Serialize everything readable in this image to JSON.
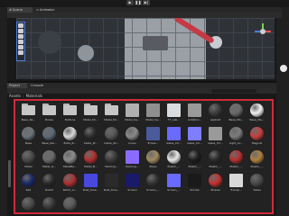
{
  "window": {
    "tabs": [
      {
        "label": "# Scene"
      },
      {
        "label": "≈ Animator"
      }
    ],
    "play_controls": [
      "▶",
      "❚❚",
      "▶|"
    ]
  },
  "project": {
    "tabs": [
      {
        "label": "Project"
      },
      {
        "label": "Console"
      }
    ],
    "search_placeholder": "",
    "breadcrumb": [
      "Assets",
      "Materials"
    ]
  },
  "colors": {
    "selection_frame": "#d12a3a",
    "accent_blue": "#4a7be0"
  },
  "assets": [
    {
      "label": "Base_Re...",
      "kind": "folder",
      "color": "#c6c6c6"
    },
    {
      "label": "Boxes",
      "kind": "folder",
      "color": "#c6c6c6"
    },
    {
      "label": "Buttons",
      "kind": "folder",
      "color": "#c6c6c6"
    },
    {
      "label": "Metal_Sh...",
      "kind": "folder",
      "color": "#c6c6c6"
    },
    {
      "label": "Metal_Sh...",
      "kind": "folder",
      "color": "#c6c6c6"
    },
    {
      "label": "Metal_Sq...",
      "kind": "square",
      "color": "#b0b0b0"
    },
    {
      "label": "Metal_Sq...",
      "kind": "square",
      "color": "#8f8f8f"
    },
    {
      "label": "TT_Lab...",
      "kind": "square",
      "color": "#d8dcdf"
    },
    {
      "label": "Antishro...",
      "kind": "square",
      "color": "#9a9a9a"
    },
    {
      "label": "Asphalt",
      "kind": "ball",
      "color": "#3d3d3d"
    },
    {
      "label": "Base_Ma...",
      "kind": "ball",
      "color": "#6a6a6a"
    },
    {
      "label": "Base_Ma...",
      "kind": "ball",
      "color": "#f2f2f2"
    },
    {
      "label": "Base",
      "kind": "ball",
      "color": "#6d747a"
    },
    {
      "label": "Base_Ma...",
      "kind": "ball",
      "color": "#5e6a78"
    },
    {
      "label": "Bolts_B...",
      "kind": "ball",
      "color": "#d8d8d8"
    },
    {
      "label": "Cable_Pr...",
      "kind": "ball",
      "color": "#2d2d2d"
    },
    {
      "label": "Cable_Sh...",
      "kind": "ball",
      "color": "#555555"
    },
    {
      "label": "Cover",
      "kind": "ball",
      "color": "#8a8a8a"
    },
    {
      "label": "Emiss...",
      "kind": "square",
      "color": "#4a5a9a"
    },
    {
      "label": "Glass_Ch...",
      "kind": "square",
      "color": "#6a6aff"
    },
    {
      "label": "Glass_Ch...",
      "kind": "square",
      "color": "#7e7eff"
    },
    {
      "label": "Glass_Ch...",
      "kind": "square",
      "color": "#9a9a9a"
    },
    {
      "label": "Light_Lo...",
      "kind": "ball",
      "color": "#7c7c7c"
    },
    {
      "label": "Magnet",
      "kind": "ball",
      "color": "#c84040"
    },
    {
      "label": "Metal",
      "kind": "ball",
      "color": "#4a4a4a"
    },
    {
      "label": "Metal_G...",
      "kind": "ball",
      "color": "#6a6a6a"
    },
    {
      "label": "MetalBe...",
      "kind": "ball",
      "color": "#8c8c8c"
    },
    {
      "label": "Metal_B...",
      "kind": "ball",
      "color": "#b0302e"
    },
    {
      "label": "Packing...",
      "kind": "ball",
      "color": "#3c3c3c"
    },
    {
      "label": "Packing...",
      "kind": "square",
      "color": "#8a6aff"
    },
    {
      "label": "Pipes",
      "kind": "ball",
      "color": "#a08a60"
    },
    {
      "label": "Plastic_...",
      "kind": "ball",
      "color": "#e8e8e8"
    },
    {
      "label": "Plastic_...",
      "kind": "ball",
      "color": "#1e1e1e"
    },
    {
      "label": "Plastic_...",
      "kind": "ball",
      "color": "#2a2a2a"
    },
    {
      "label": "Plastic_...",
      "kind": "ball",
      "color": "#b83030"
    },
    {
      "label": "Plastic_...",
      "kind": "ball",
      "color": "#b08040"
    },
    {
      "label": "Red",
      "kind": "ball",
      "color": "#1a2a6a"
    },
    {
      "label": "Robot",
      "kind": "ball",
      "color": "#2a2a2a"
    },
    {
      "label": "Robot_Li...",
      "kind": "ball",
      "color": "#b03030"
    },
    {
      "label": "Rust_Sma...",
      "kind": "square",
      "color": "#4848e0"
    },
    {
      "label": "Rust_Sma...",
      "kind": "square",
      "color": "#2a2a2a"
    },
    {
      "label": "Screen",
      "kind": "square",
      "color": "#1a1a6a"
    },
    {
      "label": "Screen_...",
      "kind": "ball",
      "color": "#333333"
    },
    {
      "label": "Screen_...",
      "kind": "square",
      "color": "#6a6aff"
    },
    {
      "label": "Smoke",
      "kind": "square",
      "color": "#1a1a1a"
    },
    {
      "label": "Stripes",
      "kind": "ball",
      "color": "#c83030"
    },
    {
      "label": "Transp...",
      "kind": "square",
      "color": "#d8d8d8"
    },
    {
      "label": "Tubes",
      "kind": "ball",
      "color": "#4a4a4a"
    },
    {
      "label": "",
      "kind": "ball",
      "color": "#4a4a4a"
    },
    {
      "label": "",
      "kind": "ball",
      "color": "#3a3a3a"
    },
    {
      "label": "",
      "kind": "ball",
      "color": "#5a5a5a"
    }
  ]
}
